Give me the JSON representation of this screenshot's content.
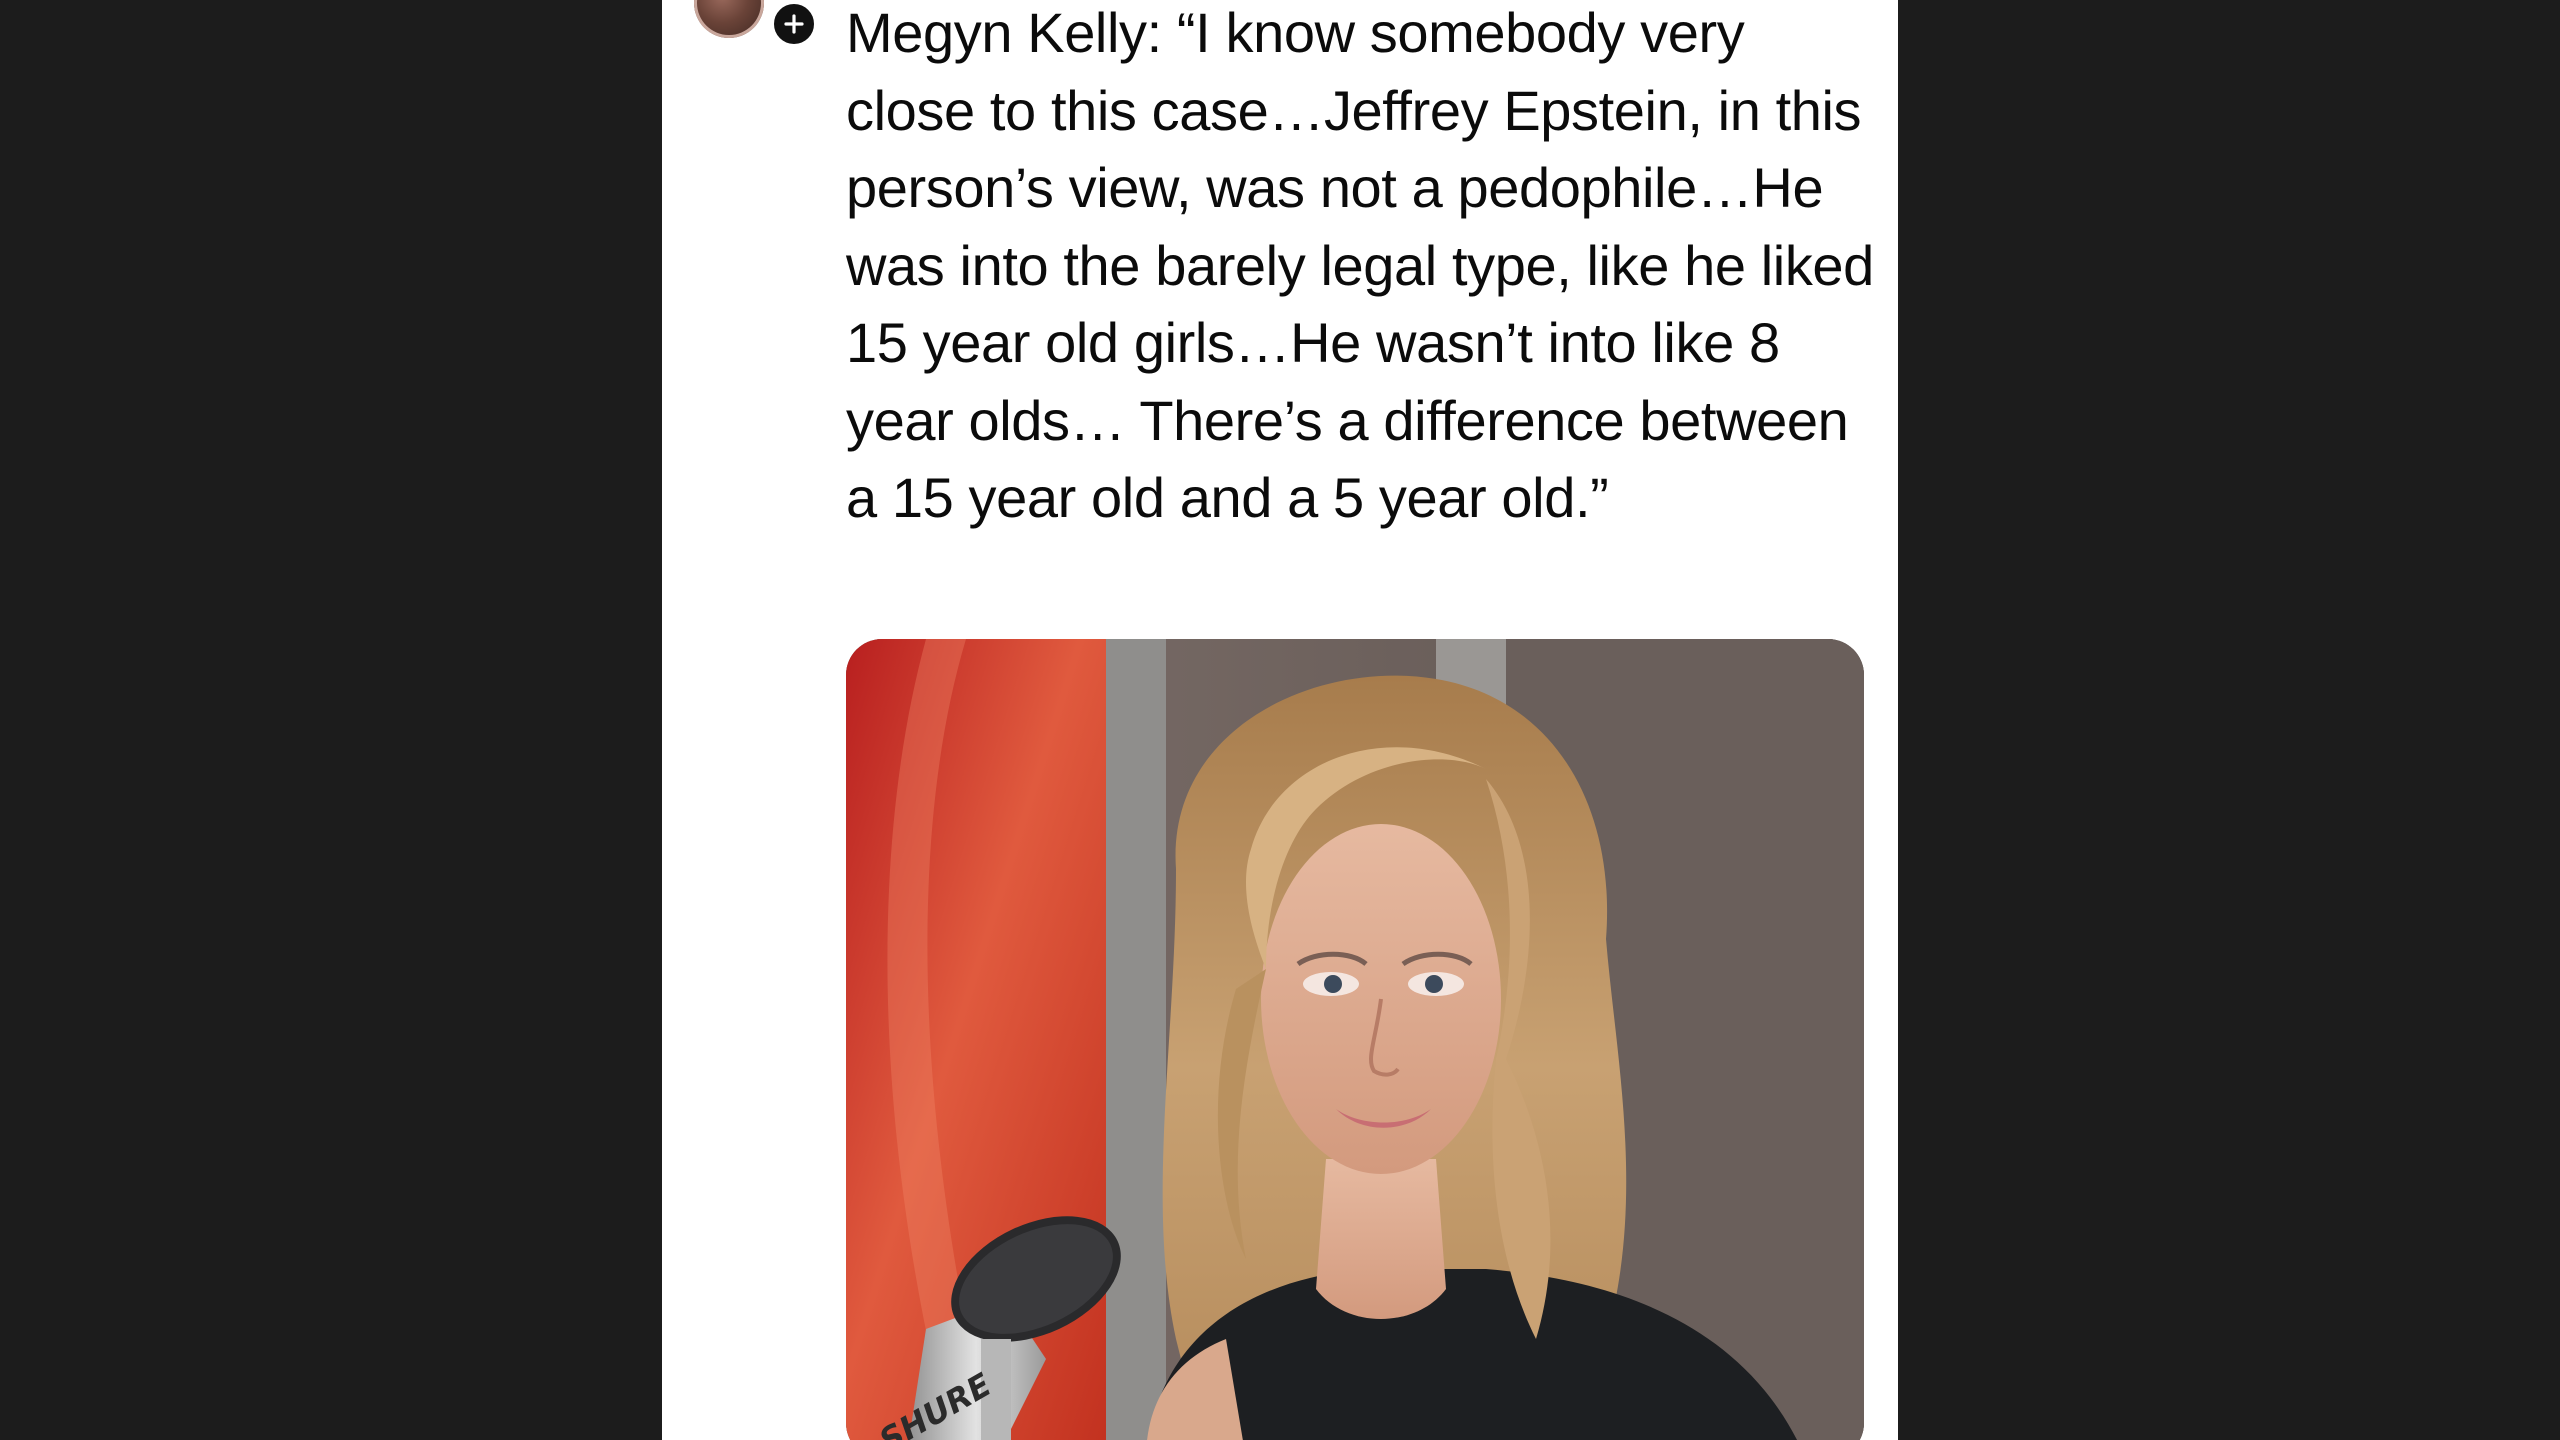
{
  "post": {
    "text": "Megyn Kelly: “I know somebody very close to this case…Jeffrey Epstein, in this person’s view, was not a pedophile…He was into the barely legal type, like he liked 15 year old girls…He wasn’t into like 8 year olds… There’s a difference between a 15 year old and a 5 year old.”",
    "avatar_icon": "profile-avatar",
    "follow_icon": "plus-icon",
    "media": {
      "description_icon": "photo",
      "mic_brand": "SHURE"
    }
  },
  "colors": {
    "background": "#1c1c1c",
    "card": "#ffffff",
    "text": "#0b0b0b",
    "badge": "#111111"
  }
}
